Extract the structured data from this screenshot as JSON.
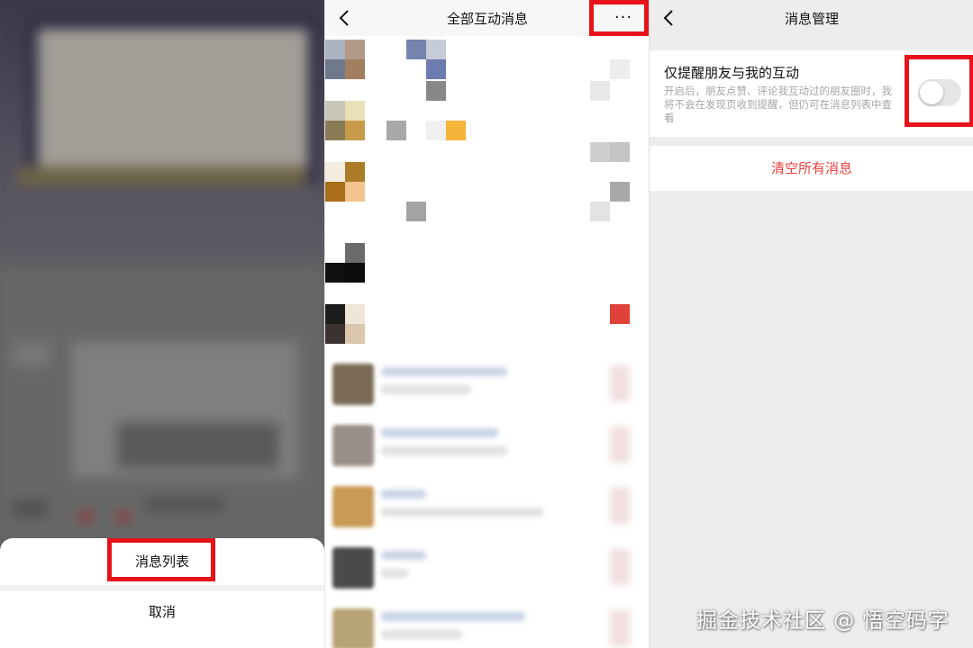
{
  "panel_left": {
    "sheet": {
      "message_list_label": "消息列表",
      "cancel_label": "取消"
    }
  },
  "panel_middle": {
    "title": "全部互动消息",
    "more_label": "···"
  },
  "panel_right": {
    "title": "消息管理",
    "option": {
      "title": "仅提醒朋友与我的互动",
      "description": "开启后，朋友点赞、评论我互动过的朋友圈时，我将不会在发现页收到提醒，但仍可在消息列表中查看",
      "toggle_on": false
    },
    "clear_label": "清空所有消息"
  },
  "watermark": "掘金技术社区 @ 悟空码字",
  "colors": {
    "highlight": "#e8131a",
    "danger_text": "#e64340",
    "toggle_off": "#e6e6e6"
  }
}
